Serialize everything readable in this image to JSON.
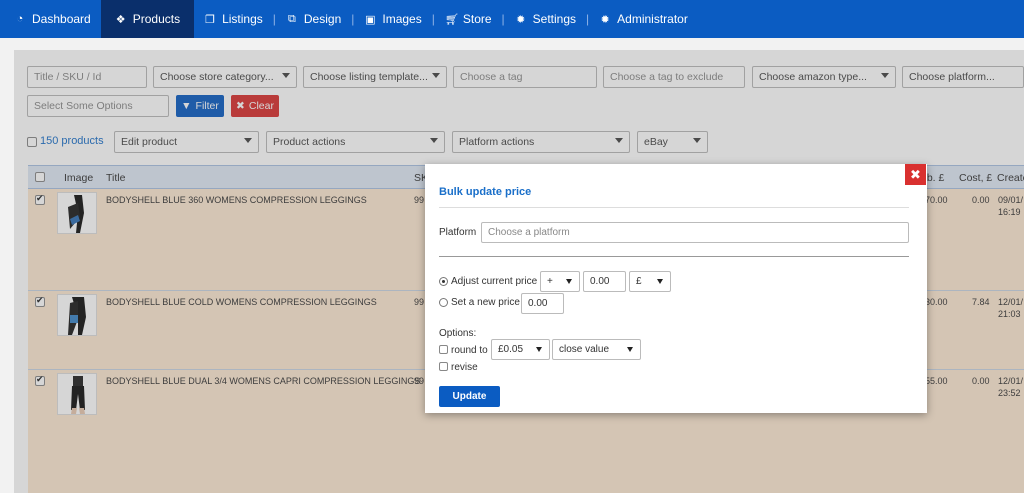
{
  "nav": {
    "items": [
      {
        "label": "Dashboard",
        "icon": "dashboard-icon"
      },
      {
        "label": "Products",
        "icon": "cubes-icon"
      },
      {
        "label": "Listings",
        "icon": "copy-icon"
      },
      {
        "label": "Design",
        "icon": "design-icon"
      },
      {
        "label": "Images",
        "icon": "image-icon"
      },
      {
        "label": "Store",
        "icon": "cart-icon"
      },
      {
        "label": "Settings",
        "icon": "gear-icon"
      },
      {
        "label": "Administrator",
        "icon": "gear-icon"
      }
    ],
    "active": "Products"
  },
  "filters": {
    "search_placeholder": "Title / SKU / Id",
    "store_category": "Choose store category...",
    "listing_template": "Choose listing template...",
    "tag_placeholder": "Choose a tag",
    "tag_exclude_placeholder": "Choose a tag to exclude",
    "amazon_type": "Choose amazon type...",
    "platform": "Choose platform...",
    "options_placeholder": "Select Some Options",
    "filter_label": "Filter",
    "clear_label": "Clear"
  },
  "actions": {
    "count_label": "150 products",
    "edit_product": "Edit product",
    "product_actions": "Product actions",
    "platform_actions": "Platform actions",
    "platform_select": "eBay"
  },
  "table": {
    "headers": {
      "image": "Image",
      "title": "Title",
      "sku": "SK",
      "price": "eb. £",
      "cost": "Cost, £",
      "created": "Create"
    },
    "rows": [
      {
        "title": "BODYSHELL BLUE 360 WOMENS COMPRESSION LEGGINGS",
        "sku": "99",
        "price": "70.00",
        "cost": "0.00",
        "date": "09/01/",
        "time": "16:19"
      },
      {
        "title": "BODYSHELL BLUE COLD WOMENS COMPRESSION LEGGINGS",
        "sku": "99",
        "price": "30.00",
        "cost": "7.84",
        "date": "12/01/",
        "time": "21:03"
      },
      {
        "title": "BODYSHELL BLUE DUAL 3/4 WOMENS CAPRI COMPRESSION LEGGINGS",
        "sku": "99",
        "price": "55.00",
        "cost": "0.00",
        "date": "12/01/",
        "time": "23:52"
      }
    ]
  },
  "modal": {
    "title": "Bulk update price",
    "platform_label": "Platform",
    "platform_placeholder": "Choose a platform",
    "adjust_label": "Adjust current price",
    "operator": "+",
    "adjust_value": "0.00",
    "currency": "£",
    "set_label": "Set a new price",
    "set_value": "0.00",
    "options_label": "Options:",
    "round_label": "round to",
    "round_value": "£0.05",
    "round_mode": "close value",
    "revise_label": "revise",
    "update_label": "Update",
    "close_label": "✖"
  }
}
